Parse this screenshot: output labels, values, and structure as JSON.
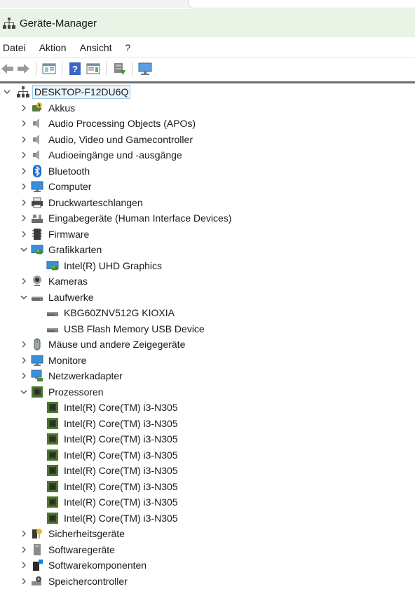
{
  "window": {
    "title": "Geräte-Manager"
  },
  "menu": [
    "Datei",
    "Aktion",
    "Ansicht",
    "?"
  ],
  "toolbar_icons": [
    "back-arrow-icon",
    "forward-arrow-icon",
    "properties-pane-icon",
    "help-icon",
    "view-icon",
    "scan-hardware-icon",
    "monitor-icon"
  ],
  "tree": {
    "root": "DESKTOP-F12DU6Q",
    "nodes": [
      {
        "label": "Akkus",
        "icon": "battery-icon",
        "state": "collapsed"
      },
      {
        "label": "Audio Processing Objects (APOs)",
        "icon": "speaker-icon",
        "state": "collapsed"
      },
      {
        "label": "Audio, Video und Gamecontroller",
        "icon": "speaker-icon",
        "state": "collapsed"
      },
      {
        "label": "Audioeingänge und -ausgänge",
        "icon": "speaker-icon",
        "state": "collapsed"
      },
      {
        "label": "Bluetooth",
        "icon": "bluetooth-icon",
        "state": "collapsed"
      },
      {
        "label": "Computer",
        "icon": "monitor-icon",
        "state": "collapsed"
      },
      {
        "label": "Druckwarteschlangen",
        "icon": "printer-icon",
        "state": "collapsed"
      },
      {
        "label": "Eingabegeräte (Human Interface Devices)",
        "icon": "hid-icon",
        "state": "collapsed"
      },
      {
        "label": "Firmware",
        "icon": "firmware-icon",
        "state": "collapsed"
      },
      {
        "label": "Grafikkarten",
        "icon": "display-adapter-icon",
        "state": "expanded",
        "children": [
          {
            "label": "Intel(R) UHD Graphics",
            "icon": "display-adapter-icon"
          }
        ]
      },
      {
        "label": "Kameras",
        "icon": "camera-icon",
        "state": "collapsed"
      },
      {
        "label": "Laufwerke",
        "icon": "drive-icon",
        "state": "expanded",
        "children": [
          {
            "label": "KBG60ZNV512G KIOXIA",
            "icon": "drive-icon"
          },
          {
            "label": "USB Flash Memory USB Device",
            "icon": "drive-icon"
          }
        ]
      },
      {
        "label": "Mäuse und andere Zeigegeräte",
        "icon": "mouse-icon",
        "state": "collapsed"
      },
      {
        "label": "Monitore",
        "icon": "monitor-icon",
        "state": "collapsed"
      },
      {
        "label": "Netzwerkadapter",
        "icon": "network-icon",
        "state": "collapsed"
      },
      {
        "label": "Prozessoren",
        "icon": "processor-icon",
        "state": "expanded",
        "children": [
          {
            "label": "Intel(R) Core(TM) i3-N305",
            "icon": "processor-icon"
          },
          {
            "label": "Intel(R) Core(TM) i3-N305",
            "icon": "processor-icon"
          },
          {
            "label": "Intel(R) Core(TM) i3-N305",
            "icon": "processor-icon"
          },
          {
            "label": "Intel(R) Core(TM) i3-N305",
            "icon": "processor-icon"
          },
          {
            "label": "Intel(R) Core(TM) i3-N305",
            "icon": "processor-icon"
          },
          {
            "label": "Intel(R) Core(TM) i3-N305",
            "icon": "processor-icon"
          },
          {
            "label": "Intel(R) Core(TM) i3-N305",
            "icon": "processor-icon"
          },
          {
            "label": "Intel(R) Core(TM) i3-N305",
            "icon": "processor-icon"
          }
        ]
      },
      {
        "label": "Sicherheitsgeräte",
        "icon": "security-key-icon",
        "state": "collapsed"
      },
      {
        "label": "Softwaregeräte",
        "icon": "software-device-icon",
        "state": "collapsed"
      },
      {
        "label": "Softwarekomponenten",
        "icon": "software-component-icon",
        "state": "collapsed"
      },
      {
        "label": "Speichercontroller",
        "icon": "storage-controller-icon",
        "state": "collapsed"
      }
    ]
  }
}
